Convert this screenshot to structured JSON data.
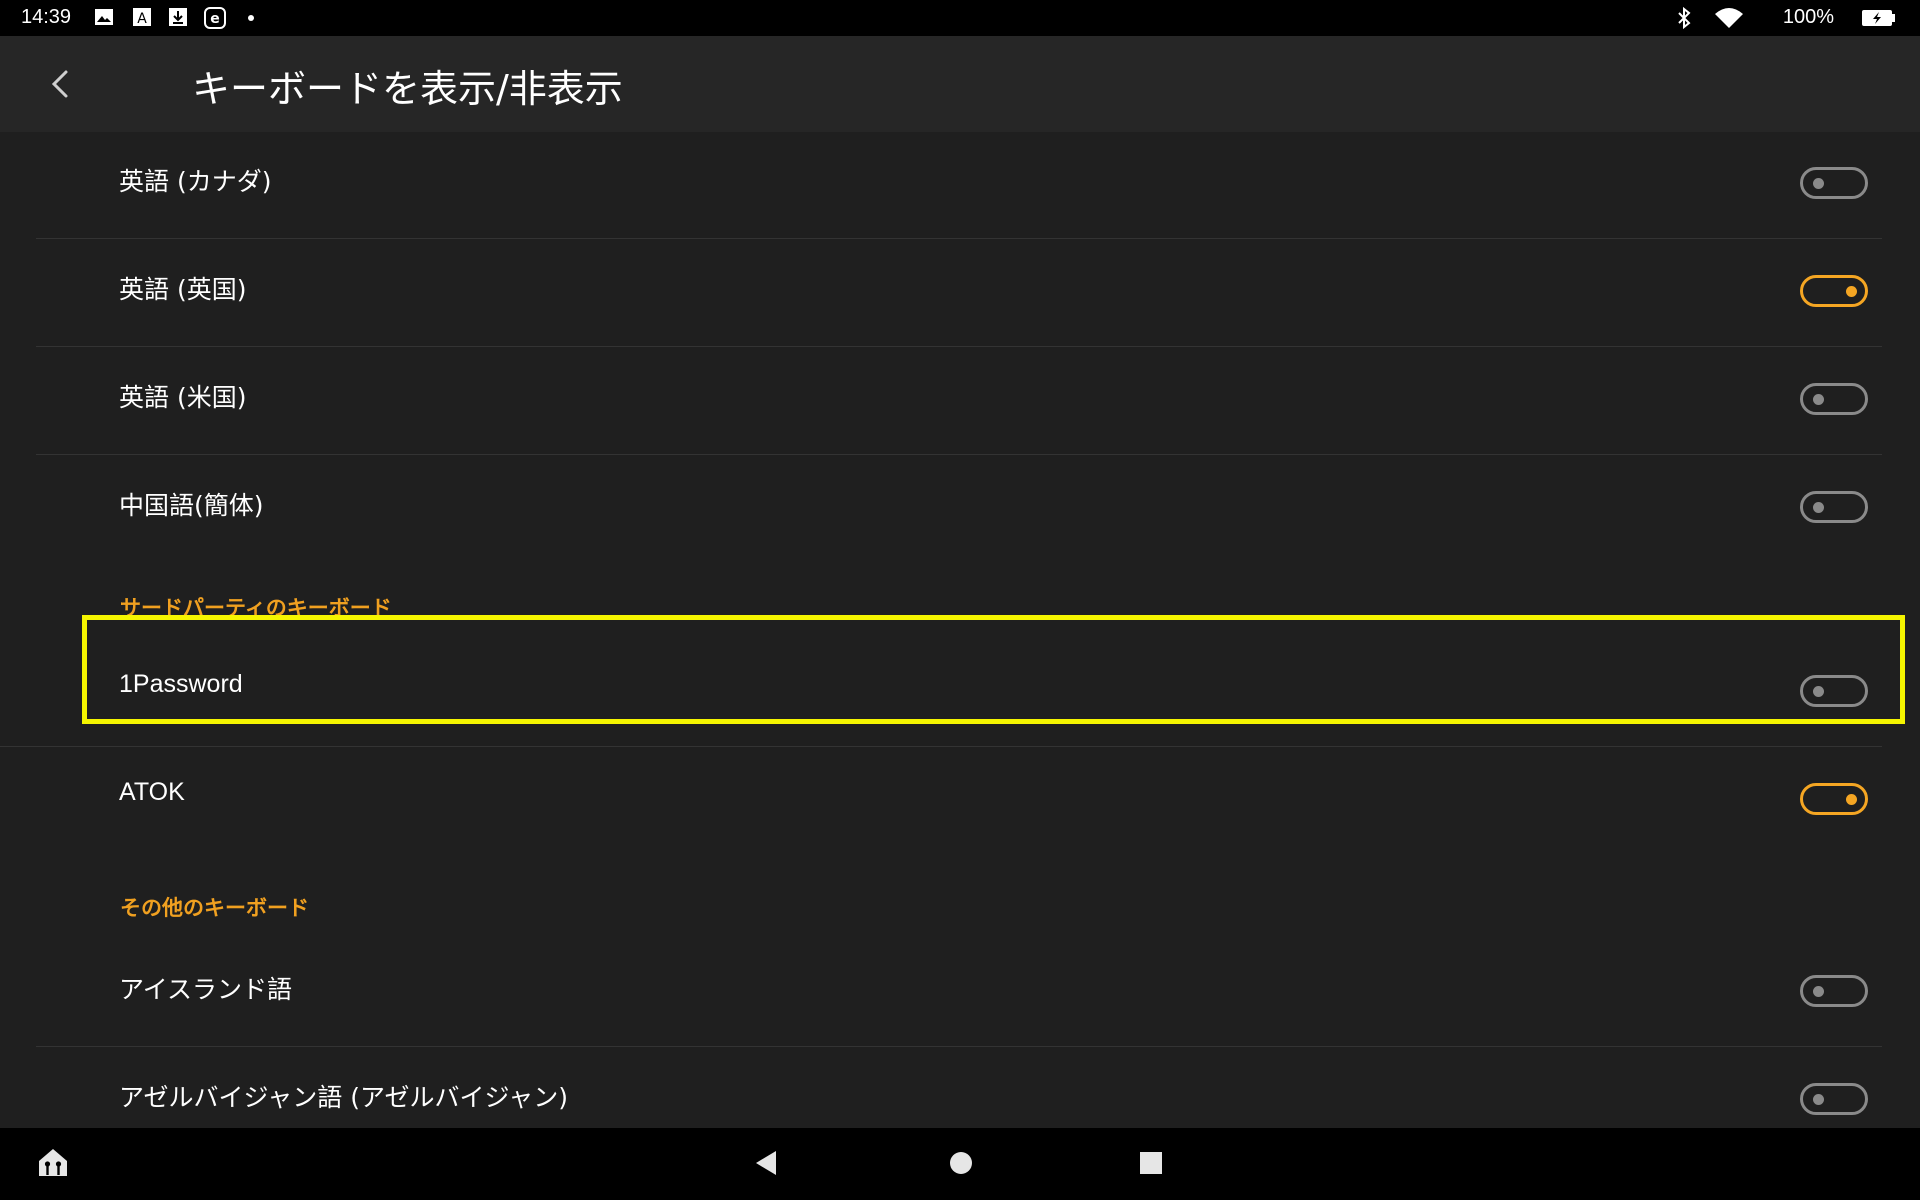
{
  "status_bar": {
    "time": "14:39",
    "battery_percent": "100%",
    "left_icons": [
      "image-icon",
      "font-a-icon",
      "download-icon",
      "e-app-icon",
      "dot-icon"
    ],
    "right_icons": [
      "bluetooth-icon",
      "wifi-icon",
      "battery-icon"
    ]
  },
  "header": {
    "title": "キーボードを表示/非表示",
    "back_icon": "chevron-left-icon"
  },
  "list": {
    "items": [
      {
        "label": "英語 (カナダ)",
        "enabled": false
      },
      {
        "label": "英語 (英国)",
        "enabled": true
      },
      {
        "label": "英語 (米国)",
        "enabled": false
      },
      {
        "label": "中国語(簡体)",
        "enabled": false
      }
    ],
    "section_third_party": "サードパーティのキーボード",
    "third_party": [
      {
        "label": "1Password",
        "enabled": false
      },
      {
        "label": "ATOK",
        "enabled": true
      }
    ],
    "section_other": "その他のキーボード",
    "other": [
      {
        "label": "アイスランド語",
        "enabled": false
      },
      {
        "label": "アゼルバイジャン語 (アゼルバイジャン)",
        "enabled": false
      }
    ]
  },
  "nav_bar": {
    "icons": [
      "home-apps-icon",
      "back-triangle-icon",
      "home-circle-icon",
      "recents-square-icon"
    ]
  },
  "colors": {
    "accent": "#f5a623",
    "highlight": "#f5f500",
    "background": "#1f1f1f",
    "header": "#262626"
  }
}
